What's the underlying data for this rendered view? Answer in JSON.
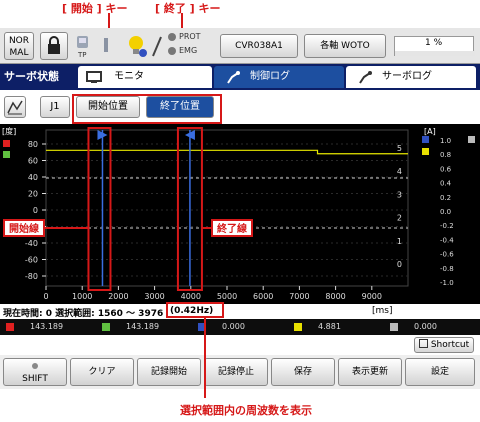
{
  "annotations": {
    "start_key": "[ 開始 ] キー",
    "end_key": "[ 終了 ] キー",
    "start_line": "開始線",
    "end_line": "終了線",
    "freq_note": "選択範囲内の周波数を表示"
  },
  "topbar": {
    "mode_line1": "NOR",
    "mode_line2": "MAL",
    "tp_label": "TP",
    "prot_label": "PROT",
    "emg_label": "EMG",
    "program": "CVR038A1",
    "axis": "各軸 WOTO",
    "percent": "1 %"
  },
  "tabs": {
    "servo_status": "サーボ状態",
    "monitor": "モニタ",
    "control_log": "制御ログ",
    "servo_log": "サーボログ"
  },
  "toolbar": {
    "j1": "J1",
    "start_pos": "開始位置",
    "end_pos": "終了位置"
  },
  "chart_data": {
    "type": "line",
    "ylabel_left": "[度]",
    "ylabel_right": "[A]",
    "yticks_left": [
      "80",
      "60",
      "40",
      "20",
      "0",
      "-20",
      "-40",
      "-60",
      "-80"
    ],
    "yticks_right": [
      "5",
      "4",
      "3",
      "2",
      "1",
      "0"
    ],
    "yticks_far_right": [
      "1.0",
      "0.8",
      "0.6",
      "0.4",
      "0.2",
      "0.0",
      "-0.2",
      "-0.4",
      "-0.6",
      "-0.8",
      "-1.0"
    ],
    "xticks": [
      "0",
      "1000",
      "2000",
      "3000",
      "4000",
      "5000",
      "6000",
      "7000",
      "8000",
      "9000"
    ],
    "xunit": "[ms]",
    "xlim": [
      0,
      10000
    ],
    "start_ms": 1560,
    "end_ms": 3976,
    "series": [
      {
        "color": "#e8e800",
        "x": [
          0,
          7500,
          7500,
          10000
        ],
        "y_right": [
          5.1,
          5.1,
          4.95,
          4.95
        ]
      }
    ]
  },
  "infobar": {
    "text": "現在時間: 0  選択範囲: 1560 ～ 3976",
    "freq": "(0.42Hz)",
    "unit": "[ms]"
  },
  "legend": [
    {
      "color": "#e02020",
      "value": "143.189"
    },
    {
      "color": "#60c040",
      "value": "143.189"
    },
    {
      "color": "#3050c0",
      "value": "0.000"
    },
    {
      "color": "#e8e000",
      "value": "4.881"
    },
    {
      "color": "#bbbbbb",
      "value": "0.000"
    }
  ],
  "shortcut": "Shortcut",
  "bottom": {
    "shift": "SHIFT",
    "clear": "クリア",
    "record_start": "記録開始",
    "record_stop": "記録停止",
    "save": "保存",
    "refresh": "表示更新",
    "settings": "設定"
  }
}
